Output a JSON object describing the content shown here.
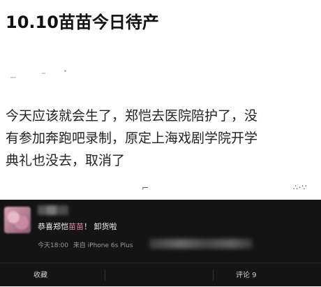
{
  "headline": "10.10苗苗今日待产",
  "body_text": "今天应该就会生了，郑恺去医院陪护了，没\n有参加奔跑吧录制，原定上海戏剧学院开学\n典礼也没去，取消了",
  "post": {
    "text_prefix": "恭喜郑恺",
    "text_highlight": "苗苗",
    "text_suffix": "！ 卸货啦",
    "time": "今天18:00",
    "source": "来自 iPhone 6s Plus"
  },
  "actions": {
    "favorite": "收藏",
    "comment": "评论 9"
  },
  "colors": {
    "card_background": "#141414",
    "highlight": "#e08aa8"
  }
}
